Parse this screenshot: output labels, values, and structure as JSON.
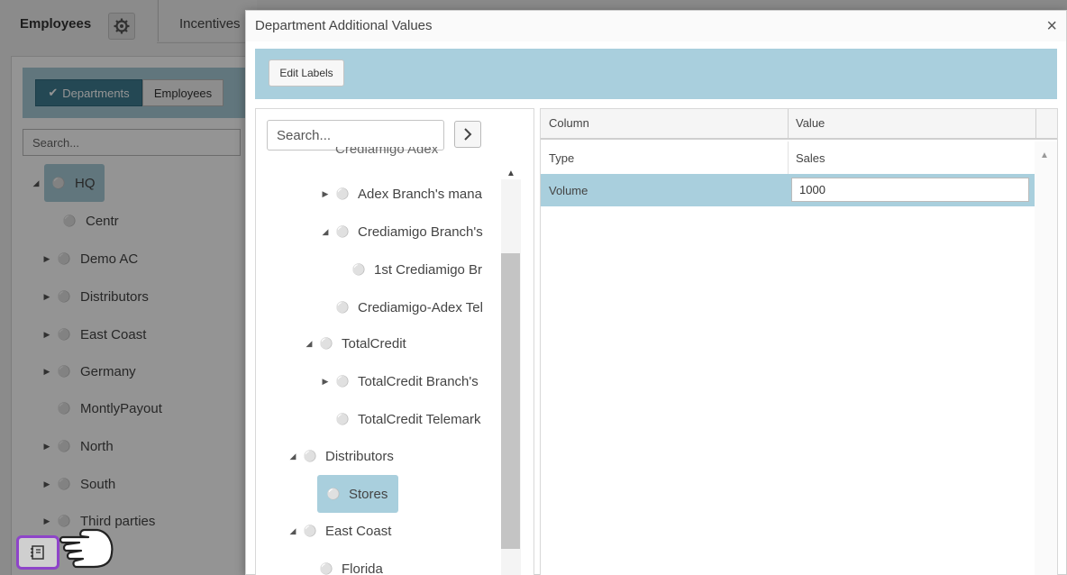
{
  "background": {
    "tabs": {
      "employees": "Employees",
      "incentives": "Incentives",
      "gear_icon": "gear-icon"
    },
    "toggle": {
      "departments": "Departments",
      "employees": "Employees",
      "check_icon": "✔"
    },
    "search_placeholder": "Search...",
    "tree": [
      {
        "label": "HQ",
        "expander": "◢",
        "selected": true
      },
      {
        "label": "Centr",
        "expander": ""
      },
      {
        "label": "Demo AC",
        "expander": "▶"
      },
      {
        "label": "Distributors",
        "expander": "▶"
      },
      {
        "label": "East Coast",
        "expander": "▶"
      },
      {
        "label": "Germany",
        "expander": "▶"
      },
      {
        "label": "MontlyPayout",
        "expander": ""
      },
      {
        "label": "North",
        "expander": "▶"
      },
      {
        "label": "South",
        "expander": "▶"
      },
      {
        "label": "Third parties",
        "expander": "▶"
      }
    ]
  },
  "dialog": {
    "title": "Department Additional Values",
    "close_glyph": "×",
    "toolbar": {
      "edit_labels": "Edit Labels"
    },
    "tree_search_placeholder": "Search...",
    "tree_partial_top": "Crediamigo Adex",
    "tree": [
      {
        "label": "Adex Branch's mana",
        "expander": "▶"
      },
      {
        "label": "Crediamigo Branch's",
        "expander": "◢"
      },
      {
        "label": "1st Crediamigo Br",
        "expander": ""
      },
      {
        "label": "Crediamigo-Adex Tel",
        "expander": ""
      },
      {
        "label": "TotalCredit",
        "expander": "◢"
      },
      {
        "label": "TotalCredit Branch's",
        "expander": "▶"
      },
      {
        "label": "TotalCredit Telemark",
        "expander": ""
      },
      {
        "label": "Distributors",
        "expander": "◢"
      },
      {
        "label": "Stores",
        "expander": "",
        "selected": true
      },
      {
        "label": "East Coast",
        "expander": "◢"
      },
      {
        "label": "Florida",
        "expander": ""
      }
    ],
    "grid": {
      "columns": [
        "Column",
        "Value"
      ],
      "rows": [
        {
          "column": "Type",
          "value": "Sales"
        },
        {
          "column": "Volume",
          "value": "1000",
          "editing": true
        }
      ]
    }
  },
  "colors": {
    "accent_light": "#a9cfdd",
    "accent_dark": "#3f7d92",
    "highlight_border": "#8e44c9"
  }
}
